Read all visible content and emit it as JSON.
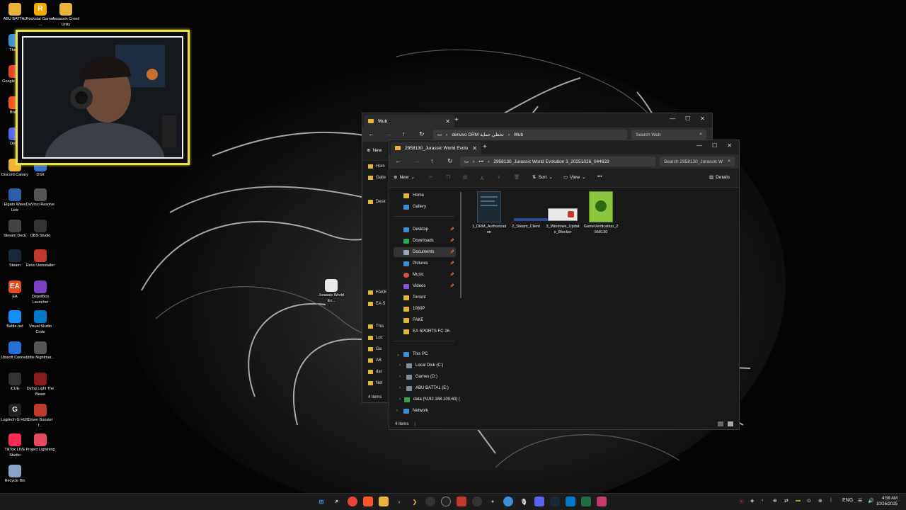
{
  "desktop": {
    "icons": [
      {
        "label": "ABU BATTAL",
        "glyph": "",
        "color": "#e8b53a"
      },
      {
        "label": "Rockstar Games ...",
        "glyph": "R",
        "color": "#f2a900"
      },
      {
        "label": "Assassin Creed Unity",
        "glyph": "",
        "color": "#e8b53a"
      },
      {
        "label": "This P",
        "glyph": "",
        "color": "#3b8fd9"
      },
      {
        "label": "Google Chrom",
        "glyph": "",
        "color": "#ea4335"
      },
      {
        "label": "Brave",
        "glyph": "",
        "color": "#fb542b"
      },
      {
        "label": "Disco",
        "glyph": "",
        "color": "#5865f2"
      },
      {
        "label": "Discord Canary",
        "glyph": "",
        "color": "#f0b232"
      },
      {
        "label": "DSX",
        "glyph": "",
        "color": "#3a6fd8"
      },
      {
        "label": "Elgato Wave Link",
        "glyph": "",
        "color": "#2d5fa8"
      },
      {
        "label": "DaVinci Resolve",
        "glyph": "",
        "color": "#555"
      },
      {
        "label": "Stream Deck",
        "glyph": "",
        "color": "#444"
      },
      {
        "label": "OBS Studio",
        "glyph": "",
        "color": "#333"
      },
      {
        "label": "Steam",
        "glyph": "",
        "color": "#1b2838"
      },
      {
        "label": "Revo Uninstaller",
        "glyph": "",
        "color": "#c0392b"
      },
      {
        "label": "EA",
        "glyph": "EA",
        "color": "#e64a19"
      },
      {
        "label": "DepotBox Launcher",
        "glyph": "",
        "color": "#7b3fbf"
      },
      {
        "label": "Battle.net",
        "glyph": "",
        "color": "#148eff"
      },
      {
        "label": "Visual Studio Code",
        "glyph": "",
        "color": "#007acc"
      },
      {
        "label": "Ubisoft Connect",
        "glyph": "",
        "color": "#2a6fd8"
      },
      {
        "label": "Little Nightmar...",
        "glyph": "",
        "color": "#555"
      },
      {
        "label": "iCUE",
        "glyph": "",
        "color": "#333"
      },
      {
        "label": "Dying Light The Beast",
        "glyph": "",
        "color": "#8b1a1a"
      },
      {
        "label": "Logitech G HUB",
        "glyph": "G",
        "color": "#222"
      },
      {
        "label": "Driver Booster f...",
        "glyph": "",
        "color": "#c0392b"
      },
      {
        "label": "TikTok LIVE Studio",
        "glyph": "",
        "color": "#fe2c55"
      },
      {
        "label": "Project Lightning",
        "glyph": "",
        "color": "#e84a5f"
      },
      {
        "label": "Recycle Bin",
        "glyph": "",
        "color": "#8aa4c8"
      },
      {
        "label": "Jurassic World Ev...",
        "glyph": "",
        "color": "#e8e8e8"
      }
    ]
  },
  "back_window": {
    "tab_title": "Wub",
    "path_segments": [
      "denuvo DRM تخطي حماية",
      "Wub"
    ],
    "search_placeholder": "Search Wub",
    "new_label": "New",
    "sidebar_partial": [
      "Hom",
      "Galle",
      "Desk",
      "FAKE",
      "EA S",
      "This",
      "Loc",
      "Ga",
      "AB",
      "dat",
      "Net"
    ],
    "status": "4 items"
  },
  "front_window": {
    "tab_title": "2958130_Jurassic World Evolu",
    "path": "2958130_Jurassic World Evolution 3_20251026_044633",
    "search_placeholder": "Search 2958130_Jurassic W",
    "toolbar": {
      "new": "New",
      "sort": "Sort",
      "view": "View",
      "more": "•••",
      "details": "Details"
    },
    "sidebar": {
      "home": "Home",
      "gallery": "Gallery",
      "desktop": "Desktop",
      "downloads": "Downloads",
      "documents": "Documents",
      "pictures": "Pictures",
      "music": "Music",
      "videos": "Videos",
      "torrent": "Torrent",
      "f1080p": "1080P",
      "fake": "FAKE",
      "easports": "EA SPORTS FC 26",
      "thispc": "This PC",
      "localdisk": "Local Disk (C:)",
      "games": "Games (D:)",
      "abubattal": "ABU BATTAL (E:)",
      "data": "data (\\\\192.168.100.60) (",
      "network": "Network"
    },
    "files": [
      {
        "name": "1_DRM_Authorization"
      },
      {
        "name": "2_Steam_Client"
      },
      {
        "name": "3_Windows_Update_Blocker"
      },
      {
        "name": "GameVerification_2958130"
      }
    ],
    "status": "4 items"
  },
  "taskbar": {
    "lang": "ENG",
    "time": "4:58 AM",
    "date": "10/26/2025",
    "colors": {
      "accent": "#0078d4",
      "bg": "#1c1c1c"
    }
  }
}
